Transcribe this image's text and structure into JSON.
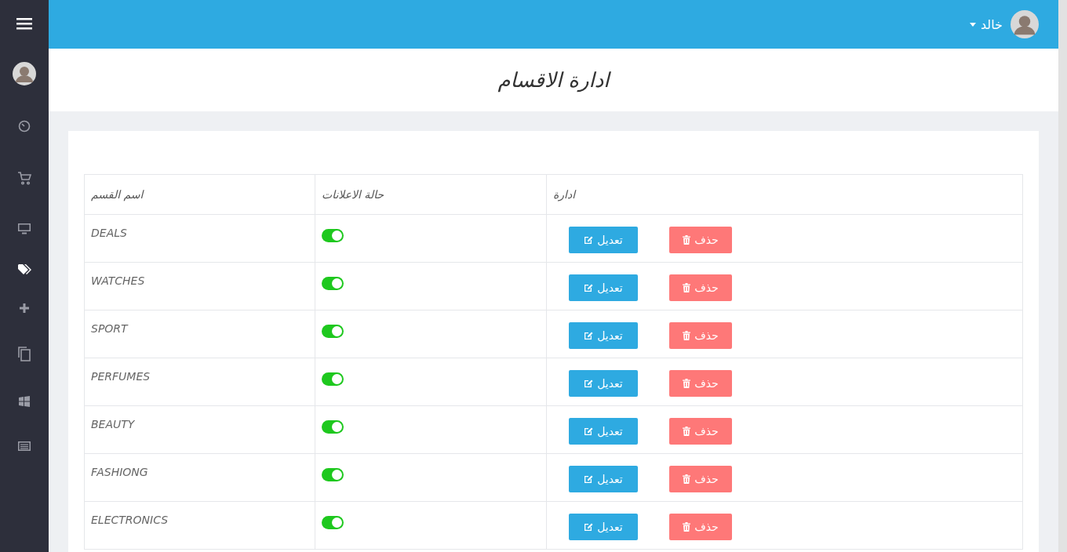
{
  "topbar": {
    "user_name": "خالد"
  },
  "sidebar": {
    "items": [
      {
        "selected": false
      },
      {
        "selected": false
      },
      {
        "selected": false
      },
      {
        "selected": true
      },
      {
        "selected": false
      },
      {
        "selected": false
      },
      {
        "selected": false
      },
      {
        "selected": false
      }
    ]
  },
  "page_title": "ادارة الاقسام",
  "table": {
    "columns": [
      "ادارة",
      "حالة الاعلانات",
      "اسم القسم"
    ],
    "rows": [
      {
        "name": "DEALS",
        "ads_on": true,
        "edit": "تعديل",
        "delete": "حذف"
      },
      {
        "name": "WATCHES",
        "ads_on": true,
        "edit": "تعديل",
        "delete": "حذف"
      },
      {
        "name": "SPORT",
        "ads_on": true,
        "edit": "تعديل",
        "delete": "حذف"
      },
      {
        "name": "PERFUMES",
        "ads_on": true,
        "edit": "تعديل",
        "delete": "حذف"
      },
      {
        "name": "BEAUTY",
        "ads_on": true,
        "edit": "تعديل",
        "delete": "حذف"
      },
      {
        "name": "FASHIONG",
        "ads_on": true,
        "edit": "تعديل",
        "delete": "حذف"
      },
      {
        "name": "ELECTRONICS",
        "ads_on": true,
        "edit": "تعديل",
        "delete": "حذف"
      }
    ]
  }
}
